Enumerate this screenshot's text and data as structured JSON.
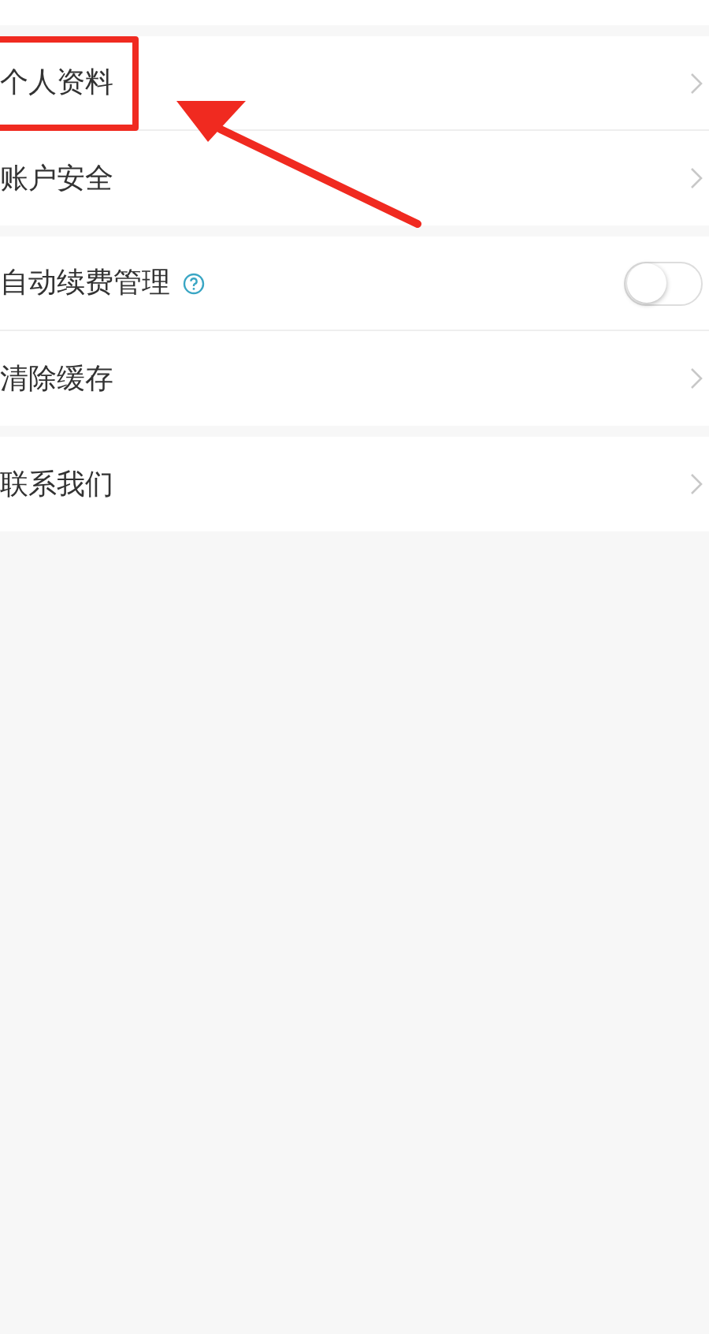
{
  "sections": [
    {
      "items": [
        {
          "kind": "link",
          "label": "个人资料",
          "highlighted": true
        },
        {
          "kind": "link",
          "label": "账户安全",
          "highlighted": false
        }
      ]
    },
    {
      "items": [
        {
          "kind": "toggle",
          "label": "自动续费管理",
          "help": true,
          "on": false,
          "highlighted": false
        },
        {
          "kind": "link",
          "label": "清除缓存",
          "highlighted": false
        }
      ]
    },
    {
      "items": [
        {
          "kind": "link",
          "label": "联系我们",
          "highlighted": false
        }
      ]
    }
  ]
}
